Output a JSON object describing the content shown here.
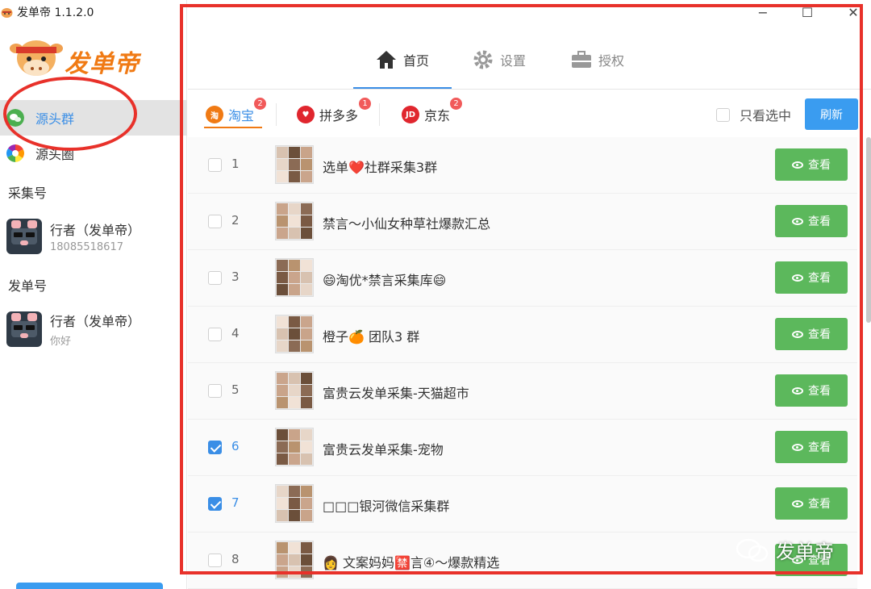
{
  "app": {
    "title": "发单帝 1.1.2.0",
    "logo_text": "发单帝"
  },
  "window_controls": {
    "minimize": "−",
    "maximize": "☐",
    "close": "✕"
  },
  "sidebar": {
    "nav": [
      {
        "label": "源头群",
        "active": true
      },
      {
        "label": "源头圈",
        "active": false
      }
    ],
    "collect_label": "采集号",
    "collect_account": {
      "name": "行者（发单帝）",
      "sub": "18085518617"
    },
    "send_label": "发单号",
    "send_account": {
      "name": "行者（发单帝）",
      "sub": "你好"
    }
  },
  "top_tabs": [
    {
      "label": "首页",
      "icon": "home-icon",
      "active": true
    },
    {
      "label": "设置",
      "icon": "gear-icon",
      "active": false
    },
    {
      "label": "授权",
      "icon": "briefcase-icon",
      "active": false
    }
  ],
  "platform_tabs": [
    {
      "label": "淘宝",
      "badge": "2",
      "icon_text": "淘",
      "color": "#f07a14",
      "active": true
    },
    {
      "label": "拼多多",
      "badge": "1",
      "icon_text": "♥",
      "color": "#e0262e",
      "active": false
    },
    {
      "label": "京东",
      "badge": "2",
      "icon_text": "JD",
      "color": "#e0262e",
      "active": false
    }
  ],
  "filter": {
    "only_selected_label": "只看选中",
    "refresh_label": "刷新"
  },
  "groups": [
    {
      "num": "1",
      "name": "选单❤️社群采集3群",
      "checked": false,
      "view": "查看"
    },
    {
      "num": "2",
      "name": "禁言～小仙女种草社爆款汇总",
      "checked": false,
      "view": "查看"
    },
    {
      "num": "3",
      "name": "😄淘优*禁言采集库😄",
      "checked": false,
      "view": "查看"
    },
    {
      "num": "4",
      "name": "橙子🍊 团队3 群",
      "checked": false,
      "view": "查看"
    },
    {
      "num": "5",
      "name": "富贵云发单采集-天猫超市",
      "checked": false,
      "view": "查看"
    },
    {
      "num": "6",
      "name": "富贵云发单采集-宠物",
      "checked": true,
      "view": "查看"
    },
    {
      "num": "7",
      "name": "□□□银河微信采集群",
      "checked": true,
      "view": "查看"
    },
    {
      "num": "8",
      "name": "👩 文案妈妈🈲言④～爆款精选",
      "checked": false,
      "view": "查看"
    }
  ],
  "watermark": "发单帝",
  "colors": {
    "accent": "#3a8ee6",
    "view_button": "#5cb85c",
    "annotation": "#e8312a",
    "refresh": "#3a9cf0"
  }
}
